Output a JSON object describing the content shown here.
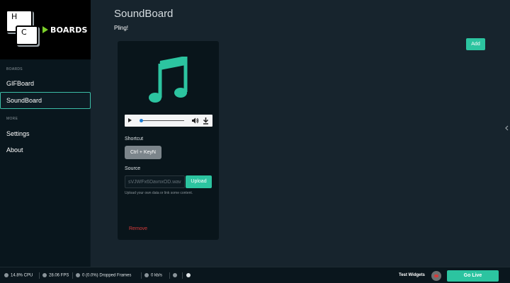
{
  "logo": {
    "key_h": "H",
    "key_c": "C",
    "brand": "BOARDS"
  },
  "sidebar": {
    "sections": [
      {
        "label": "BOARDS",
        "items": [
          {
            "label": "GIFBoard",
            "active": false
          },
          {
            "label": "SoundBoard",
            "active": true
          }
        ]
      },
      {
        "label": "MORE",
        "items": [
          {
            "label": "Settings",
            "active": false
          },
          {
            "label": "About",
            "active": false
          }
        ]
      }
    ]
  },
  "main": {
    "title": "SoundBoard",
    "subtitle": "Pling!",
    "add_label": "Add",
    "card": {
      "icon": "music-note-icon",
      "player": {
        "progress": 0
      },
      "shortcut_label": "Shortcut",
      "shortcut_value": "Ctrl + KeyN",
      "source_label": "Source",
      "source_value": "sVJWFx6DavnxOD.wav",
      "upload_label": "Upload",
      "hint": "Upload your own data or link some content.",
      "remove_label": "Remove"
    }
  },
  "statusbar": {
    "cpu": "14.8% CPU",
    "fps": "28.06 FPS",
    "dropped": "0 (0.0%) Dropped Frames",
    "bitrate": "0 kb/s",
    "test_widgets": "Test Widgets",
    "go_live": "Go Live"
  },
  "colors": {
    "accent": "#2cc4a0",
    "danger": "#d83a3a",
    "background": "#17242d",
    "sidebar": "#09161d"
  }
}
